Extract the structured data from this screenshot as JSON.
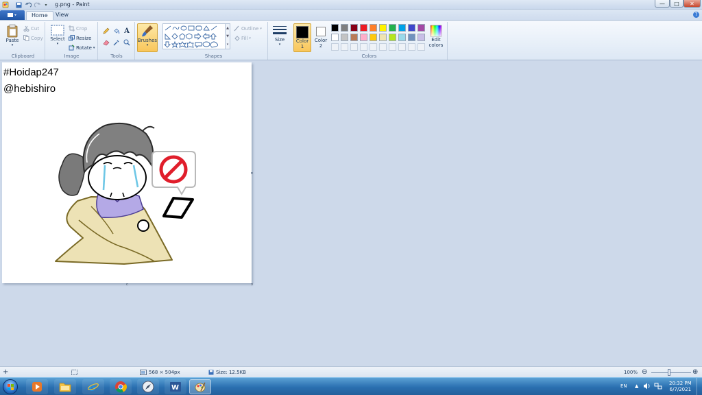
{
  "window": {
    "title": "g.png - Paint",
    "controls": {
      "minimize": "—",
      "maximize": "□",
      "close": "✕"
    }
  },
  "tabs": [
    {
      "label": "Home",
      "active": true
    },
    {
      "label": "View",
      "active": false
    }
  ],
  "ribbon": {
    "clipboard": {
      "label": "Clipboard",
      "paste": "Paste",
      "cut": "Cut",
      "copy": "Copy"
    },
    "image": {
      "label": "Image",
      "select": "Select",
      "crop": "Crop",
      "resize": "Resize",
      "rotate": "Rotate"
    },
    "tools": {
      "label": "Tools",
      "text_glyph": "A"
    },
    "brushes": {
      "label": "Brushes"
    },
    "shapes": {
      "label": "Shapes",
      "outline": "Outline",
      "fill": "Fill"
    },
    "size": {
      "label": "Size"
    },
    "colors": {
      "label": "Colors",
      "color1": "Color 1",
      "color2": "Color 2",
      "edit_colors": "Edit colors",
      "color1_value": "#000000",
      "color2_value": "#ffffff",
      "palette_row1": [
        "#000000",
        "#7f7f7f",
        "#880015",
        "#ed1c24",
        "#ff7f27",
        "#fff200",
        "#22b14c",
        "#00a2e8",
        "#3f48cc",
        "#a349a4"
      ],
      "palette_row2": [
        "#ffffff",
        "#c3c3c3",
        "#b97a57",
        "#ffaec9",
        "#ffc90e",
        "#efe4b0",
        "#b5e61d",
        "#99d9ea",
        "#7092be",
        "#c8bfe7"
      ]
    }
  },
  "canvas": {
    "line1": "#Hoidap247",
    "line2": "@hebishiro"
  },
  "status": {
    "dimensions": "568 × 504px",
    "size": "Size: 12.5KB",
    "zoom": "100%"
  },
  "taskbar": {
    "language": "EN",
    "time": "20:32 PM",
    "date": "6/7/2021"
  }
}
